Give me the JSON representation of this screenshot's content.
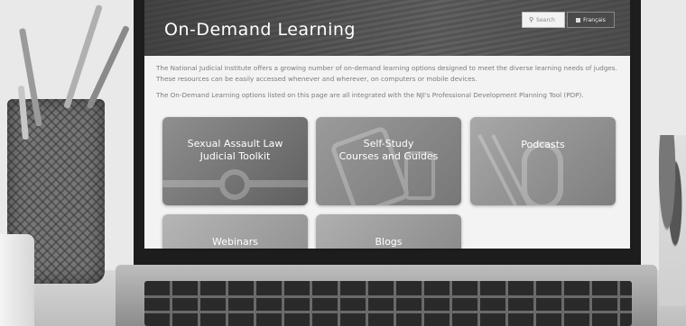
{
  "header": {
    "title": "On-Demand Learning",
    "search_placeholder": "Search",
    "language_button": "Français"
  },
  "intro": {
    "paragraph1": "The National Judicial Institute offers a growing number of on-demand learning options designed to meet the diverse learning needs of judges. These resources can be easily accessed whenever and wherever, on computers or mobile devices.",
    "paragraph2": "The On-Demand Learning options listed on this page are all integrated with the NJI's Professional Development Planning Tool (PDP)."
  },
  "tiles": [
    {
      "line1": "Sexual Assault Law",
      "line2": "Judicial Toolkit"
    },
    {
      "line1": "Self-Study",
      "line2": "Courses and Guides"
    },
    {
      "line1": "Podcasts",
      "line2": ""
    },
    {
      "line1": "Webinars",
      "line2": ""
    },
    {
      "line1": "Blogs",
      "line2": ""
    }
  ],
  "icons": {
    "search": "magnifier-icon",
    "language": "globe-icon"
  }
}
